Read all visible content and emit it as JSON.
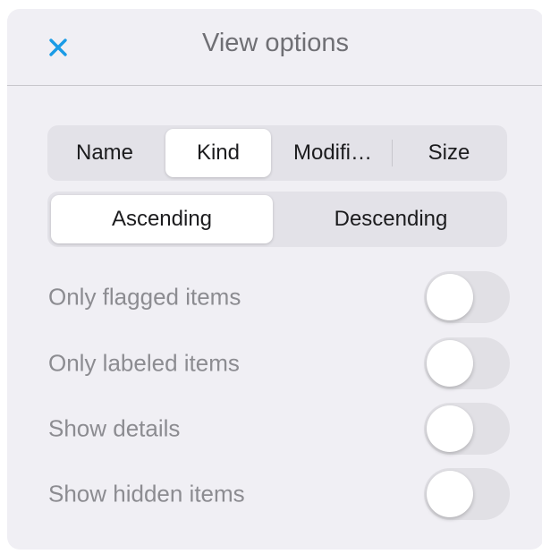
{
  "header": {
    "title": "View options",
    "close_icon": "close-icon",
    "accent": "#1a9be6"
  },
  "sort": {
    "options": [
      "Name",
      "Kind",
      "Modifi…",
      "Size"
    ],
    "selected": "Kind"
  },
  "order": {
    "options": [
      "Ascending",
      "Descending"
    ],
    "selected": "Ascending"
  },
  "toggles": [
    {
      "label": "Only flagged items",
      "on": false
    },
    {
      "label": "Only labeled items",
      "on": false
    },
    {
      "label": "Show details",
      "on": false
    },
    {
      "label": "Show hidden items",
      "on": false
    }
  ]
}
